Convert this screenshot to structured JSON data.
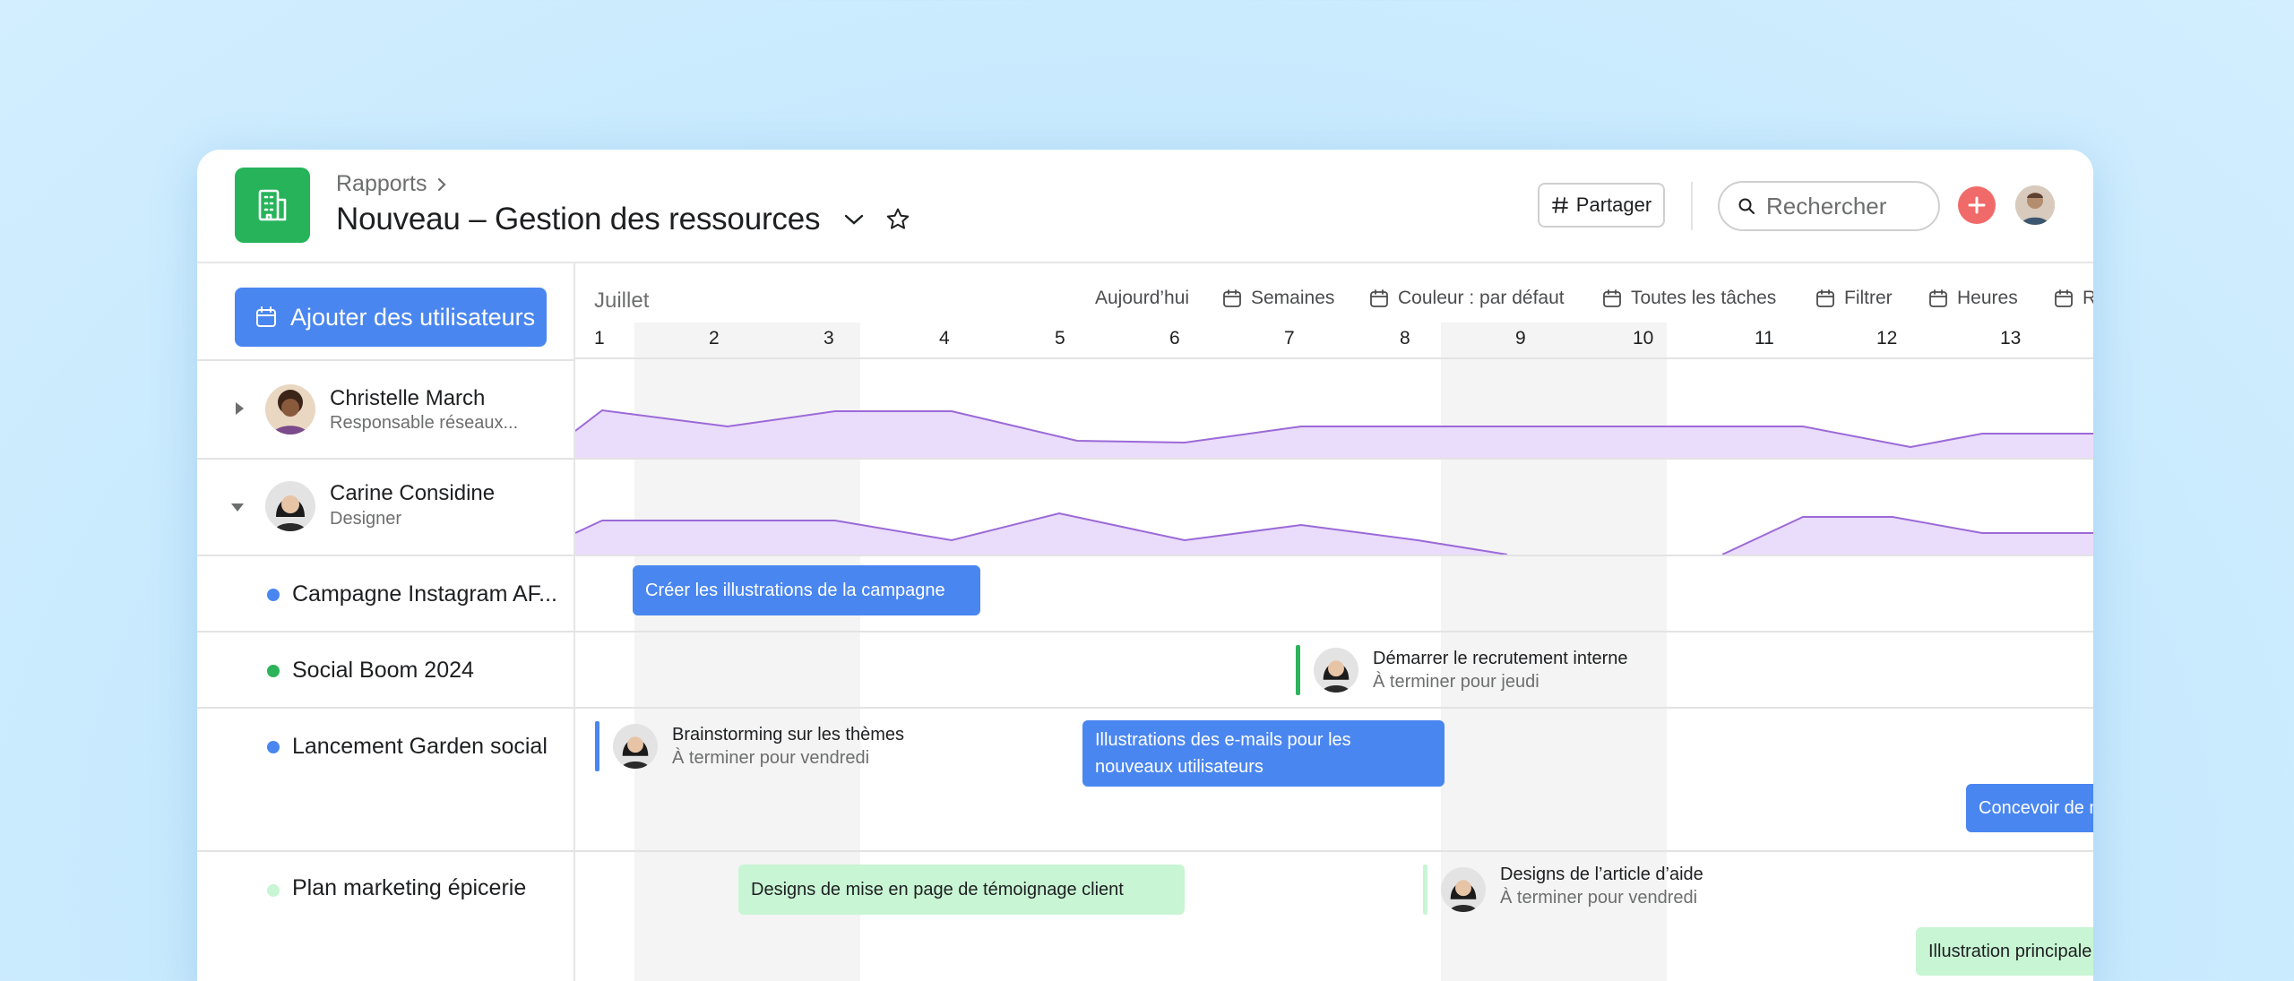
{
  "header": {
    "breadcrumb": "Rapports",
    "title": "Nouveau – Gestion des ressources",
    "share_label": "Partager",
    "search_placeholder": "Rechercher"
  },
  "left_panel": {
    "add_users_label": "Ajouter des utilisateurs",
    "people": [
      {
        "name": "Christelle March",
        "role": "Responsable réseaux..."
      },
      {
        "name": "Carine Considine",
        "role": "Designer"
      }
    ],
    "projects": [
      {
        "label": "Campagne Instagram AF...",
        "color": "#4a86f0"
      },
      {
        "label": "Social Boom 2024",
        "color": "#2db35a"
      },
      {
        "label": "Lancement Garden social",
        "color": "#4a86f0"
      },
      {
        "label": "Plan marketing épicerie",
        "color": "#c8f5d4"
      }
    ]
  },
  "timeline": {
    "month": "Juillet",
    "toolbar": {
      "today": "Aujourd’hui",
      "weeks": "Semaines",
      "color": "Couleur : par défaut",
      "all_tasks": "Toutes les tâches",
      "filter": "Filtrer",
      "hours": "Heures",
      "workload": "Répartition du travail"
    },
    "days": [
      "1",
      "2",
      "3",
      "4",
      "5",
      "6",
      "7",
      "8",
      "9",
      "10",
      "11",
      "12",
      "13"
    ],
    "tasks": {
      "t1": "Créer les illustrations de la campagne",
      "t2_title": "Démarrer le recrutement interne",
      "t2_sub": "À terminer pour jeudi",
      "t3_title": "Brainstorming sur les thèmes",
      "t3_sub": "À terminer pour vendredi",
      "t4_line1": "Illustrations des e-mails pour les",
      "t4_line2": "nouveaux utilisateurs",
      "t5": "Concevoir de nouvelles illustrations",
      "t6": "Designs de mise en page de témoignage client",
      "t7_title": "Designs de l’article d’aide",
      "t7_sub": "À terminer pour vendredi",
      "t8": "Illustration principale du blog"
    },
    "workload_colors": {
      "fill": "#eadcfb",
      "stroke": "#9b6ad8"
    }
  }
}
